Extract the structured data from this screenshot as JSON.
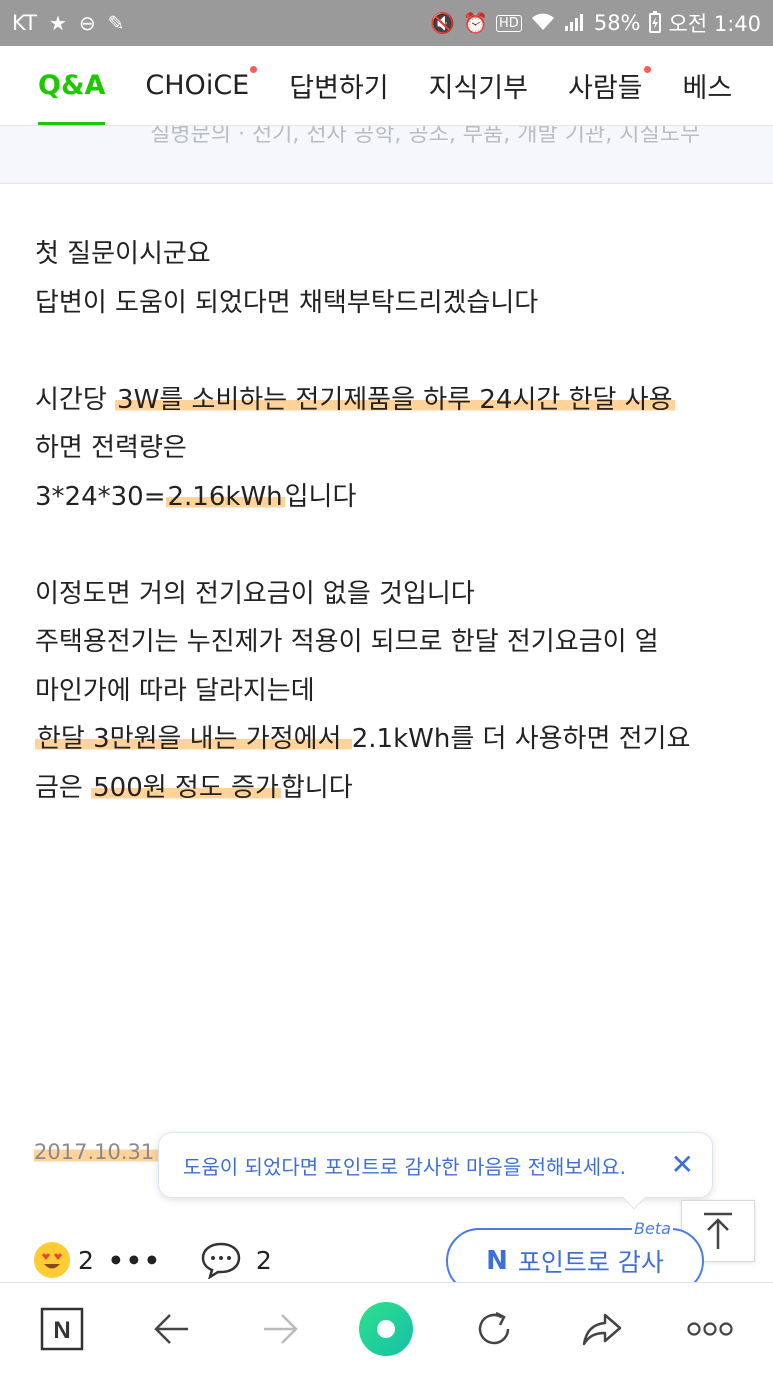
{
  "status_bar": {
    "carrier": "KT",
    "battery": "58%",
    "time": "오전 1:40"
  },
  "tabs": [
    {
      "label": "Q&A",
      "active": true,
      "dot": false
    },
    {
      "label": "CHOiCE",
      "active": false,
      "dot": true
    },
    {
      "label": "답변하기",
      "active": false,
      "dot": false
    },
    {
      "label": "지식기부",
      "active": false,
      "dot": false
    },
    {
      "label": "사람들",
      "active": false,
      "dot": true
    },
    {
      "label": "베스",
      "active": false,
      "dot": false
    }
  ],
  "tag_strip": {
    "text": "질병문의 · 전기, 전자 공학, 공조, 부품, 개발 기관, 지칠노무"
  },
  "answer": {
    "line1": "첫 질문이시군요",
    "line2": "답변이 도움이 되었다면 채택부탁드리겠습니다",
    "p2_a": "시간당 ",
    "p2_hl": "3W를 소비하는 전기제품을 하루 24시간  한달 사용",
    "p2_b": "하면 전력량은",
    "p2_c": "3*24*30=",
    "p2_hl2": "2.16kWh",
    "p2_d": "입니다",
    "p3_a": "이정도면 거의 전기요금이 없을 것입니다",
    "p3_b": "주택용전기는 누진제가 적용이 되므로 한달 전기요금이 얼",
    "p3_c": "마인가에 따라 달라지는데",
    "p3_hl": "한달 3만원을 내는 가정에서 ",
    "p3_d": "2.1kWh를 더 사용하면 전기요",
    "p3_e": "금은 ",
    "p3_hl2": "500원 정도 증가",
    "p3_f": "합니다"
  },
  "meta": {
    "date": "2017.10.31",
    "tooltip": "도움이 되었다면 포인트로 감사한 마음을 전해보세요.",
    "tooltip_close": "✕"
  },
  "reactions": {
    "emoji": "😍",
    "emoji_count": "2",
    "more": "•••",
    "comment_count": "2"
  },
  "point_button": {
    "icon": "N",
    "label": "포인트로 감사",
    "badge": "Beta"
  },
  "browser_bar": {
    "home_icon": "N",
    "items": [
      "naver-home-icon",
      "back-icon",
      "forward-icon",
      "green-dot-icon",
      "reload-icon",
      "share-icon",
      "more-icon"
    ]
  },
  "colors": {
    "accent_green": "#1ec800",
    "link_blue": "#3e6fd8",
    "highlight": "#ffc478",
    "status_bar_gray": "#9a9a9a"
  }
}
